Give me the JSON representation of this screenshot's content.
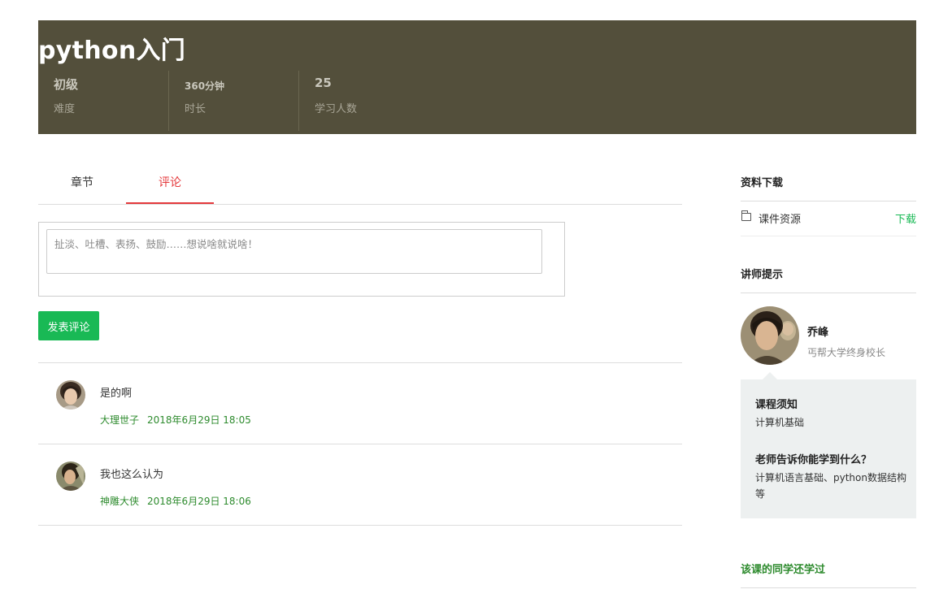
{
  "course": {
    "title": "python入门",
    "stats": [
      {
        "value": "初级",
        "label": "难度"
      },
      {
        "value": "360分钟",
        "label": "时长"
      },
      {
        "value": "25",
        "label": "学习人数"
      }
    ]
  },
  "tabs": [
    {
      "label": "章节",
      "active": false
    },
    {
      "label": "评论",
      "active": true
    }
  ],
  "comment_form": {
    "placeholder": "扯淡、吐槽、表扬、鼓励……想说啥就说啥！",
    "value": "",
    "submit_label": "发表评论"
  },
  "comments": [
    {
      "text": "是的啊",
      "author": "大理世子",
      "time": "2018年6月29日 18:05"
    },
    {
      "text": "我也这么认为",
      "author": "神雕大侠",
      "time": "2018年6月29日 18:06"
    }
  ],
  "sidebar": {
    "downloads_title": "资料下载",
    "resource": {
      "name": "课件资源",
      "action": "下载"
    },
    "tips_title": "讲师提示",
    "teacher": {
      "name": "乔峰",
      "title": "丐帮大学终身校长"
    },
    "notice_title": "课程须知",
    "notice_text": "计算机基础",
    "learn_title": "老师告诉你能学到什么？",
    "learn_text": "计算机语言基础、python数据结构等",
    "related_title": "该课的同学还学过"
  },
  "colors": {
    "banner": "#534f3b",
    "accent_red": "#e4393c",
    "accent_green": "#19b955",
    "meta_green": "#2e8b2e"
  }
}
